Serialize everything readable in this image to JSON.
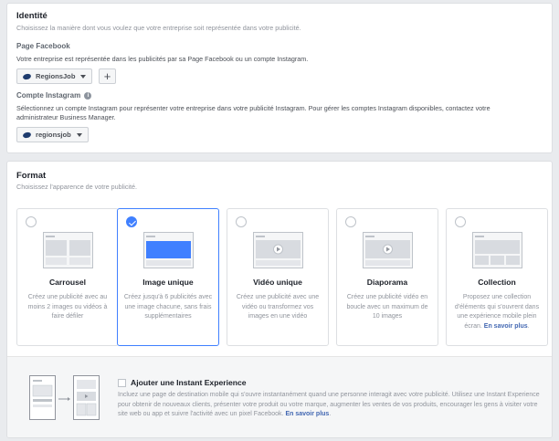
{
  "identity": {
    "title": "Identité",
    "subtitle": "Choisissez la manière dont vous voulez que votre entreprise soit représentée dans votre publicité.",
    "facebook_page": {
      "label": "Page Facebook",
      "description": "Votre entreprise est représentée dans les publicités par sa Page Facebook ou un compte Instagram.",
      "selected": "RegionsJob",
      "add_label": "+"
    },
    "instagram": {
      "label": "Compte Instagram",
      "info_glyph": "i",
      "description_line1": "Sélectionnez un compte Instagram pour représenter votre entreprise dans votre publicité Instagram. Pour gérer les comptes Instagram disponibles, contactez votre",
      "description_line2": "administrateur Business Manager.",
      "selected": "regionsjob"
    }
  },
  "format": {
    "title": "Format",
    "subtitle": "Choisissez l'apparence de votre publicité.",
    "options": [
      {
        "name": "Carrousel",
        "description": "Créez une publicité avec au moins 2 images ou vidéos à faire défiler",
        "selected": false,
        "icon": "carousel-thumbnail"
      },
      {
        "name": "Image unique",
        "description": "Créez jusqu'à 6 publicités avec une image chacune, sans frais supplémentaires",
        "selected": true,
        "icon": "single-image-thumbnail"
      },
      {
        "name": "Vidéo unique",
        "description": "Créez une publicité avec une vidéo ou transformez vos images en une vidéo",
        "selected": false,
        "icon": "video-thumbnail"
      },
      {
        "name": "Diaporama",
        "description": "Créez une publicité vidéo en boucle avec un maximum de 10 images",
        "selected": false,
        "icon": "slideshow-thumbnail"
      },
      {
        "name": "Collection",
        "description": "Proposez une collection d'éléments qui s'ouvrent dans une expérience mobile plein écran.",
        "link": "En savoir plus",
        "link_suffix": ".",
        "selected": false,
        "icon": "collection-thumbnail"
      }
    ]
  },
  "instant_experience": {
    "title": "Ajouter une Instant Experience",
    "description": "Incluez une page de destination mobile qui s'ouvre instantanément quand une personne interagit avec votre publicité. Utilisez une Instant Experience pour obtenir de nouveaux clients, présenter votre produit ou votre marque, augmenter les ventes de vos produits, encourager les gens à visiter votre site web ou app et suivre l'activité avec un pixel Facebook.",
    "link": "En savoir plus",
    "link_suffix": ".",
    "checked": false
  },
  "colors": {
    "accent": "#4080ff",
    "link": "#4267b2",
    "background": "#e9ebee"
  }
}
